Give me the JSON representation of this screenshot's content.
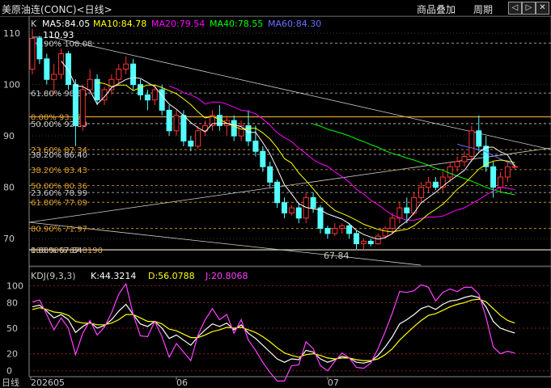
{
  "header": {
    "title": "美原油连(CONC)<日线>",
    "overlay_button": "商品叠加",
    "period_button": "周期",
    "nav_left": "◁",
    "nav_right": "▷",
    "nav_close": "✕"
  },
  "legend": {
    "k_label": "K",
    "ma5": "MA5:84.05",
    "ma10": "MA10:84.78",
    "ma20": "MA20:79.54",
    "ma40": "MA40:78.55",
    "ma60": "MA60:84.30"
  },
  "kdj_legend": {
    "name": "KDJ(9,3,3)",
    "k": "K:44.3214",
    "d": "D:56.0788",
    "j": "J:20.8068"
  },
  "annotations": {
    "high_marker": "110.93",
    "low_marker": "67.84"
  },
  "fib_labels": [
    {
      "text": "80.90% 108.08",
      "value": 108.08,
      "color": "#c8c8c8"
    },
    {
      "text": "61.80% 98.35",
      "value": 98.35,
      "color": "#c8c8c8"
    },
    {
      "text": "0.00% 93.72",
      "value": 93.72,
      "color": "#e0a030"
    },
    {
      "text": "50.00% 92.39",
      "value": 92.39,
      "color": "#c8c8c8"
    },
    {
      "text": "23.60% 87.34",
      "value": 87.34,
      "color": "#e0a030"
    },
    {
      "text": "38.20% 86.40",
      "value": 86.4,
      "color": "#c8c8c8"
    },
    {
      "text": "38.20% 83.43",
      "value": 83.43,
      "color": "#e0a030"
    },
    {
      "text": "50.00% 80.36",
      "value": 80.36,
      "color": "#e0a030"
    },
    {
      "text": "23.60% 78.99",
      "value": 78.99,
      "color": "#c8c8c8"
    },
    {
      "text": "61.80% 77.09",
      "value": 77.09,
      "color": "#e0a030"
    },
    {
      "text": "80.90% 71.97",
      "value": 71.97,
      "color": "#e0a030"
    },
    {
      "text": "100.00% 67.8190",
      "value": 67.819,
      "color": "#e0a030"
    },
    {
      "text": "0.00% 67.84",
      "value": 67.84,
      "color": "#c8c8c8"
    }
  ],
  "x_axis": {
    "ticks": [
      {
        "label": "202605",
        "index": 0
      },
      {
        "label": "06",
        "index": 20
      },
      {
        "label": "07",
        "index": 41
      }
    ],
    "period_label": "日线"
  },
  "chart_data": [
    {
      "type": "candlestick",
      "title": "美原油连(CONC)<日线>",
      "ylim": [
        65,
        113
      ],
      "yticks": [
        70,
        80,
        90,
        100,
        110
      ],
      "grid": true,
      "colors": {
        "up": "#ff3232",
        "down": "#54ffff",
        "ma5": "#ffffff",
        "ma10": "#ffff00",
        "ma20": "#ff00ff",
        "ma40": "#00ff00",
        "ma60": "#6e6eff"
      },
      "candles": [
        [
          103,
          110.9,
          102,
          109
        ],
        [
          109,
          109.5,
          104,
          105
        ],
        [
          105,
          106,
          100,
          101
        ],
        [
          101,
          104,
          98,
          102
        ],
        [
          102,
          107,
          101,
          106
        ],
        [
          106,
          106.5,
          99,
          100
        ],
        [
          100,
          101,
          88,
          92
        ],
        [
          92,
          100,
          91,
          99
        ],
        [
          99,
          103,
          98,
          101
        ],
        [
          101,
          102,
          96,
          97
        ],
        [
          97,
          99.5,
          96,
          99
        ],
        [
          99,
          102,
          98,
          101
        ],
        [
          101,
          104,
          100,
          103
        ],
        [
          103,
          105.5,
          102,
          104
        ],
        [
          104,
          105,
          99,
          100
        ],
        [
          100,
          101,
          97,
          98
        ],
        [
          98,
          99,
          95,
          97
        ],
        [
          97,
          100,
          96,
          99
        ],
        [
          99,
          100,
          94,
          95
        ],
        [
          95,
          96,
          90,
          91
        ],
        [
          91,
          95,
          90,
          94
        ],
        [
          94,
          95,
          88,
          89
        ],
        [
          89,
          90,
          87,
          88
        ],
        [
          88,
          92,
          87.5,
          91
        ],
        [
          91,
          93,
          90,
          92
        ],
        [
          92,
          95,
          91,
          94
        ],
        [
          94,
          96,
          91,
          92
        ],
        [
          92,
          94,
          90,
          93
        ],
        [
          93,
          94,
          89,
          90
        ],
        [
          90,
          93,
          89,
          92
        ],
        [
          92,
          95,
          88,
          89
        ],
        [
          89,
          92,
          86,
          87
        ],
        [
          87,
          88,
          83,
          84
        ],
        [
          84,
          85,
          80,
          81
        ],
        [
          81,
          81.5,
          76,
          77
        ],
        [
          77,
          78,
          74,
          75
        ],
        [
          75,
          76.5,
          74.5,
          76
        ],
        [
          76,
          77,
          73,
          74
        ],
        [
          74,
          79,
          73,
          78
        ],
        [
          78,
          79,
          75,
          76
        ],
        [
          76,
          76.5,
          71,
          72
        ],
        [
          72,
          72.5,
          70,
          71
        ],
        [
          71,
          73,
          70.5,
          72
        ],
        [
          72,
          73,
          71,
          72.5
        ],
        [
          72.5,
          73,
          70,
          71
        ],
        [
          71,
          71.5,
          68,
          69
        ],
        [
          69,
          70,
          67.84,
          69.5
        ],
        [
          69.5,
          70,
          68.5,
          69
        ],
        [
          69,
          71,
          68.8,
          70.5
        ],
        [
          70.5,
          72.5,
          70,
          72
        ],
        [
          72,
          75,
          71,
          74
        ],
        [
          74,
          77,
          73,
          76
        ],
        [
          76,
          78,
          73,
          75
        ],
        [
          75,
          79,
          74.5,
          78
        ],
        [
          78,
          81,
          77,
          80
        ],
        [
          80,
          82,
          79,
          81
        ],
        [
          81,
          82,
          79.5,
          80
        ],
        [
          80,
          83,
          79,
          82
        ],
        [
          82,
          85,
          81,
          84
        ],
        [
          84,
          86,
          83,
          85
        ],
        [
          85,
          87,
          84,
          86
        ],
        [
          86,
          92,
          85,
          91
        ],
        [
          91,
          94,
          87,
          88
        ],
        [
          88,
          90,
          83,
          84
        ],
        [
          84,
          85,
          78,
          80
        ],
        [
          80,
          83,
          79,
          82
        ],
        [
          82,
          85,
          81,
          84
        ],
        [
          84,
          84.5,
          83.5,
          84.05
        ]
      ],
      "ma": {
        "ma5": [
          null,
          null,
          null,
          null,
          104.6,
          102.8,
          99.8,
          99.6,
          98.8,
          96.2,
          97.6,
          99.4,
          100.2,
          101,
          101.4,
          101.2,
          100.4,
          99.6,
          97.8,
          96.2,
          95.2,
          94,
          92.6,
          91.6,
          90.8,
          92.4,
          92.4,
          92.4,
          92.2,
          91.8,
          90.7,
          90.7,
          88.7,
          86.5,
          83.6,
          80.5,
          78.7,
          76.8,
          76.1,
          75.8,
          75.6,
          74.8,
          74.3,
          73.8,
          72.9,
          71.6,
          70.8,
          70.3,
          69.9,
          70.2,
          71.0,
          72.4,
          73.4,
          75.0,
          77.0,
          78.0,
          79.0,
          80.2,
          81.3,
          82.3,
          83.3,
          85.2,
          86.8,
          87.8,
          87.8,
          86.9,
          86.3,
          84.05
        ],
        "ma10": [
          null,
          null,
          null,
          null,
          null,
          null,
          null,
          null,
          null,
          100.4,
          100.2,
          99.6,
          99.9,
          99.9,
          98.8,
          99.4,
          99.9,
          99.9,
          99.4,
          98.8,
          98.2,
          97.2,
          96.1,
          94.7,
          93.5,
          93.8,
          93.2,
          92.5,
          91.9,
          91.3,
          91.5,
          91.5,
          90.6,
          89.4,
          87.7,
          85.6,
          84.7,
          82.8,
          81.3,
          79.7,
          78.0,
          76.7,
          75.5,
          74.9,
          74.3,
          73.6,
          72.8,
          72.3,
          71.8,
          71.5,
          71.3,
          71.6,
          71.8,
          72.5,
          73.6,
          74.8,
          75.7,
          76.7,
          78.1,
          79.6,
          80.7,
          82.1,
          83.5,
          84.5,
          85.1,
          85.3,
          85.1,
          84.78
        ],
        "ma20": [
          null,
          null,
          null,
          null,
          null,
          null,
          null,
          null,
          null,
          null,
          null,
          null,
          null,
          null,
          null,
          null,
          null,
          null,
          null,
          99.7,
          99.2,
          98.4,
          98.0,
          97.3,
          96.2,
          96.6,
          96.6,
          96.2,
          95.6,
          95.0,
          94.8,
          94.3,
          93.3,
          92.1,
          90.6,
          89.7,
          88.9,
          87.6,
          86.6,
          85.4,
          84.6,
          84.1,
          83.0,
          82.1,
          81.0,
          79.6,
          78.7,
          77.5,
          76.6,
          75.6,
          74.6,
          74.1,
          73.6,
          73.6,
          73.9,
          74.2,
          74.2,
          74.4,
          75.0,
          75.6,
          76.0,
          76.8,
          77.6,
          78.5,
          79.3,
          80.0,
          79.8,
          79.54
        ],
        "ma40": [
          null,
          null,
          null,
          null,
          null,
          null,
          null,
          null,
          null,
          null,
          null,
          null,
          null,
          null,
          null,
          null,
          null,
          null,
          null,
          null,
          null,
          null,
          null,
          null,
          null,
          null,
          null,
          null,
          null,
          null,
          null,
          null,
          null,
          null,
          null,
          null,
          null,
          null,
          null,
          92.3,
          91.9,
          91.3,
          90.9,
          90.5,
          90.0,
          89.4,
          88.9,
          88.3,
          87.8,
          87.1,
          86.6,
          86.2,
          85.7,
          85.3,
          84.8,
          84.3,
          83.7,
          83.3,
          82.7,
          82.2,
          81.7,
          81.2,
          80.6,
          80.0,
          79.5,
          79.1,
          78.8,
          78.55
        ],
        "ma60": [
          null,
          null,
          null,
          null,
          null,
          null,
          null,
          null,
          null,
          null,
          null,
          null,
          null,
          null,
          null,
          null,
          null,
          null,
          null,
          null,
          null,
          null,
          null,
          null,
          null,
          null,
          null,
          null,
          null,
          null,
          null,
          null,
          null,
          null,
          null,
          null,
          null,
          null,
          null,
          null,
          null,
          null,
          null,
          null,
          null,
          null,
          null,
          null,
          null,
          null,
          null,
          null,
          null,
          null,
          null,
          null,
          null,
          null,
          null,
          88.4,
          88.0,
          87.7,
          87.3,
          86.9,
          86.2,
          85.5,
          84.9,
          84.3
        ]
      }
    },
    {
      "type": "line",
      "title": "KDJ(9,3,3)",
      "ylim": [
        -5,
        105
      ],
      "yticks": [
        0,
        20,
        50,
        80,
        100
      ],
      "series": [
        {
          "name": "K",
          "color": "#ffffff",
          "values": [
            75,
            77,
            70,
            62,
            66,
            60,
            45,
            52,
            57,
            50,
            53,
            60,
            70,
            78,
            66,
            55,
            52,
            58,
            50,
            38,
            42,
            36,
            30,
            40,
            48,
            55,
            52,
            56,
            48,
            54,
            44,
            38,
            30,
            22,
            14,
            10,
            14,
            13,
            24,
            22,
            14,
            10,
            13,
            17,
            15,
            10,
            9,
            11,
            18,
            28,
            40,
            55,
            60,
            66,
            73,
            76,
            72,
            78,
            82,
            83,
            86,
            88,
            86,
            75,
            58,
            50,
            47,
            44.32
          ]
        },
        {
          "name": "D",
          "color": "#ffff00",
          "values": [
            72,
            74,
            72,
            69,
            68,
            65,
            58,
            56,
            56,
            54,
            54,
            56,
            60,
            66,
            66,
            62,
            58,
            58,
            55,
            49,
            47,
            43,
            39,
            39,
            42,
            46,
            48,
            51,
            50,
            51,
            48,
            45,
            40,
            34,
            27,
            21,
            18,
            16,
            19,
            20,
            18,
            15,
            14,
            15,
            15,
            13,
            12,
            12,
            14,
            19,
            26,
            36,
            44,
            52,
            59,
            65,
            67,
            71,
            75,
            78,
            80,
            83,
            84,
            81,
            73,
            65,
            59,
            56.08
          ]
        },
        {
          "name": "J",
          "color": "#ff40ff",
          "values": [
            81,
            83,
            66,
            48,
            62,
            50,
            19,
            44,
            59,
            42,
            51,
            68,
            90,
            102,
            66,
            41,
            40,
            58,
            40,
            16,
            32,
            22,
            12,
            42,
            60,
            73,
            60,
            66,
            44,
            60,
            36,
            24,
            10,
            -2,
            -12,
            -12,
            6,
            7,
            34,
            26,
            6,
            0,
            11,
            21,
            15,
            4,
            3,
            9,
            26,
            46,
            68,
            93,
            92,
            94,
            101,
            98,
            82,
            92,
            96,
            93,
            98,
            98,
            90,
            63,
            28,
            20,
            23,
            20.81
          ]
        }
      ]
    }
  ]
}
